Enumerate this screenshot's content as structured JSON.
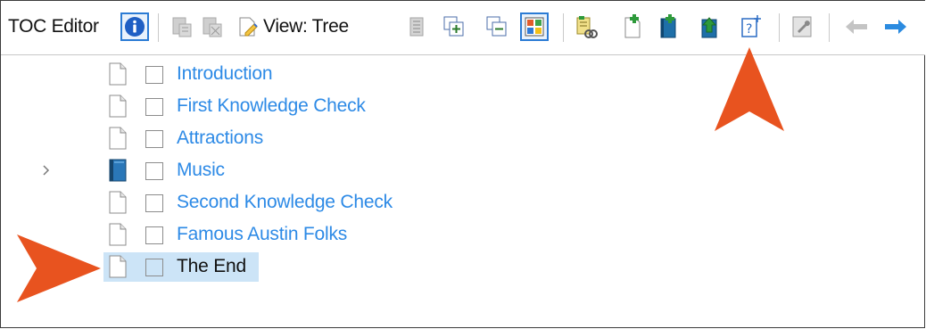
{
  "toolbar": {
    "title": "TOC Editor",
    "view_label": "View: Tree",
    "buttons": [
      "info-icon",
      "bind-icon",
      "unbind-icon",
      "view-tree-icon",
      "text-align-icon",
      "expand-all-icon",
      "collapse-all-icon",
      "grid-colors-icon",
      "link-chain-icon",
      "new-page-icon",
      "new-book-icon",
      "new-book-up-icon",
      "question-add-icon",
      "properties-wrench-icon",
      "back-arrow-icon",
      "forward-arrow-icon"
    ]
  },
  "tree": {
    "items": [
      {
        "label": "Introduction",
        "icon": "page-icon"
      },
      {
        "label": "First Knowledge Check",
        "icon": "page-icon"
      },
      {
        "label": "Attractions",
        "icon": "page-icon"
      },
      {
        "label": "Music",
        "icon": "book-icon",
        "collapsible": true
      },
      {
        "label": "Second Knowledge Check",
        "icon": "page-icon"
      },
      {
        "label": "Famous Austin Folks",
        "icon": "page-icon"
      },
      {
        "label": "The End",
        "icon": "page-icon",
        "selected": true
      }
    ]
  },
  "colors": {
    "link": "#2d8ae6",
    "selection": "#cce4f7",
    "callout_arrow": "#e8531f",
    "accent": "#2b7bd4"
  }
}
